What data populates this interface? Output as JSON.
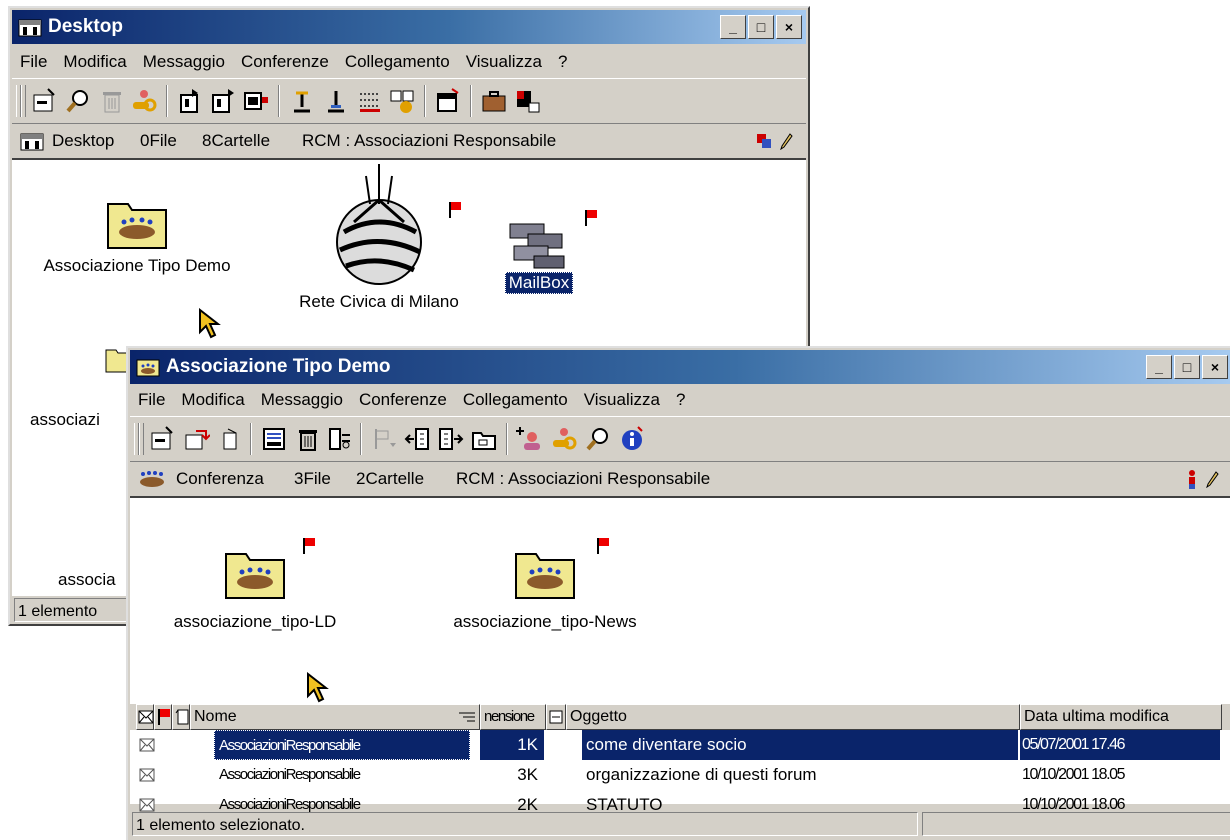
{
  "desktop_window": {
    "title": "Desktop",
    "menu": [
      "File",
      "Modifica",
      "Messaggio",
      "Conferenze",
      "Collegamento",
      "Visualizza",
      "?"
    ],
    "info": {
      "location": "Desktop",
      "files": "0File",
      "folders": "8Cartelle",
      "rcm": "RCM : Associazioni Responsabile"
    },
    "icons": [
      {
        "label": "Associazione Tipo Demo"
      },
      {
        "label": "Rete Civica di Milano"
      },
      {
        "label": "MailBox"
      }
    ],
    "partial_labels": [
      "associazi",
      "associa"
    ],
    "status": "1 elemento"
  },
  "conference_window": {
    "title": "Associazione Tipo Demo",
    "menu": [
      "File",
      "Modifica",
      "Messaggio",
      "Conferenze",
      "Collegamento",
      "Visualizza",
      "?"
    ],
    "info": {
      "location": "Conferenza",
      "files": "3File",
      "folders": "2Cartelle",
      "rcm": "RCM : Associazioni Responsabile"
    },
    "icons": [
      {
        "label": "associazione_tipo-LD"
      },
      {
        "label": "associazione_tipo-News"
      }
    ],
    "list": {
      "columns": [
        "Nome",
        "nensione",
        "Oggetto",
        "Data ultima modifica"
      ],
      "rows": [
        {
          "name": "AssociazioniResponsabile",
          "size": "1K",
          "subject": "come diventare socio",
          "date": "05/07/2001 17.46"
        },
        {
          "name": "AssociazioniResponsabile",
          "size": "3K",
          "subject": "organizzazione di questi forum",
          "date": "10/10/2001 18.05"
        },
        {
          "name": "AssociazioniResponsabile",
          "size": "2K",
          "subject": "STATUTO",
          "date": "10/10/2001 18.06"
        }
      ]
    },
    "status": "1 elemento selezionato."
  },
  "colors": {
    "titlebar_start": "#0a246a",
    "titlebar_end": "#a6caf0",
    "selection": "#0a246a",
    "window_face": "#d4d0c8"
  }
}
